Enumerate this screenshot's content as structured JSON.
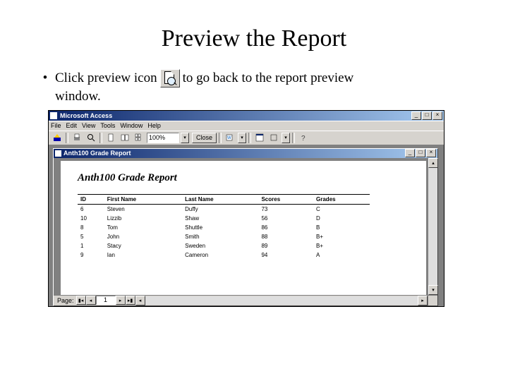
{
  "slide": {
    "title": "Preview the Report",
    "bullet_part1": "Click preview icon",
    "bullet_part2": "to go back to the report preview",
    "bullet_part3": "window."
  },
  "access": {
    "app_title": "Microsoft Access",
    "menu": {
      "file": "File",
      "edit": "Edit",
      "view": "View",
      "tools": "Tools",
      "window": "Window",
      "help": "Help"
    },
    "toolbar": {
      "zoom_value": "100%",
      "close_label": "Close"
    },
    "doc_title": "Anth100 Grade Report",
    "report_heading": "Anth100 Grade Report",
    "columns": {
      "id": "ID",
      "first": "First Name",
      "last": "Last Name",
      "scores": "Scores",
      "grades": "Grades"
    },
    "rows": [
      {
        "id": "6",
        "first": "Steven",
        "last": "Duffy",
        "score": "73",
        "grade": "C"
      },
      {
        "id": "10",
        "first": "Lizzib",
        "last": "Shaw",
        "score": "56",
        "grade": "D"
      },
      {
        "id": "8",
        "first": "Tom",
        "last": "Shuttle",
        "score": "86",
        "grade": "B"
      },
      {
        "id": "5",
        "first": "John",
        "last": "Smith",
        "score": "88",
        "grade": "B+"
      },
      {
        "id": "1",
        "first": "Stacy",
        "last": "Sweden",
        "score": "89",
        "grade": "B+"
      },
      {
        "id": "9",
        "first": "Ian",
        "last": "Cameron",
        "score": "94",
        "grade": "A"
      }
    ],
    "pagenav": {
      "label": "Page:",
      "current": "1"
    }
  }
}
